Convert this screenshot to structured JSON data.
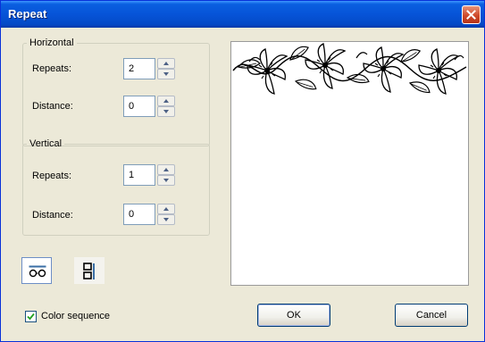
{
  "window": {
    "title": "Repeat"
  },
  "horizontal": {
    "legend": "Horizontal",
    "repeats_label": "Repeats:",
    "repeats_value": "2",
    "distance_label": "Distance:",
    "distance_value": "0"
  },
  "vertical": {
    "legend": "Vertical",
    "repeats_label": "Repeats:",
    "repeats_value": "1",
    "distance_label": "Distance:",
    "distance_value": "0"
  },
  "tools": {
    "horizontal_icon": "horizontal-repeat-icon",
    "vertical_icon": "vertical-repeat-icon",
    "selected": "horizontal"
  },
  "color_sequence": {
    "label": "Color sequence",
    "checked": true
  },
  "preview": {
    "icon": "floral-border-icon"
  },
  "buttons": {
    "ok": "OK",
    "cancel": "Cancel"
  },
  "colors": {
    "titlebar": "#0654d8",
    "dialog_bg": "#ece9d8",
    "close": "#cf4a2b"
  }
}
